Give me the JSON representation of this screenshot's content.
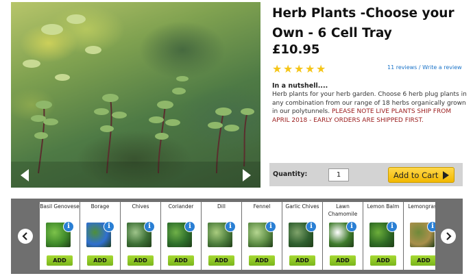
{
  "product": {
    "title": "Herb Plants -Choose your Own - 6 Cell Tray",
    "price": "£10.95",
    "rating_stars": 5,
    "reviews_count": "11 reviews",
    "reviews_separator": " / ",
    "write_review": "Write a review",
    "nutshell_heading": "In a nutshell....",
    "description": "Herb plants for your herb garden. Choose 6 herb plug plants in any combination from our range of 18 herbs organically grown in our polytunnels.",
    "notice": "PLEASE NOTE LIVE PLANTS SHIP FROM APRIL 2018 - EARLY ORDERS ARE SHIPPED FIRST."
  },
  "cart": {
    "quantity_label": "Quantity:",
    "quantity_value": "1",
    "add_to_cart": "Add to Cart"
  },
  "herbs": [
    {
      "name": "Basil Genovese",
      "add": "ADD",
      "icon": "basil-leaf-icon",
      "colors": [
        "#3f8a2a",
        "#7cc24a"
      ]
    },
    {
      "name": "Borage",
      "add": "ADD",
      "icon": "borage-flower-icon",
      "colors": [
        "#2f6fd0",
        "#4f8f3a"
      ]
    },
    {
      "name": "Chives",
      "add": "ADD",
      "icon": "chives-icon",
      "colors": [
        "#3c6f35",
        "#9ec48a"
      ]
    },
    {
      "name": "Coriander",
      "add": "ADD",
      "icon": "coriander-leaf-icon",
      "colors": [
        "#2d6e2a",
        "#6fb048"
      ]
    },
    {
      "name": "Dill",
      "add": "ADD",
      "icon": "dill-icon",
      "colors": [
        "#4c7d3c",
        "#a9cc7e"
      ]
    },
    {
      "name": "Fennel",
      "add": "ADD",
      "icon": "fennel-icon",
      "colors": [
        "#5c8c44",
        "#b5d690"
      ]
    },
    {
      "name": "Garlic Chives",
      "add": "ADD",
      "icon": "garlic-chives-icon",
      "colors": [
        "#2f5f2f",
        "#7fa36a"
      ]
    },
    {
      "name": "Lawn Chamomile",
      "add": "ADD",
      "icon": "chamomile-flower-icon",
      "colors": [
        "#3f7b2c",
        "#ffffff"
      ]
    },
    {
      "name": "Lemon Balm",
      "add": "ADD",
      "icon": "lemon-balm-leaf-icon",
      "colors": [
        "#2e6a24",
        "#6cae3a"
      ]
    },
    {
      "name": "Lemongrass",
      "add": "ADD",
      "icon": "lemongrass-icon",
      "colors": [
        "#a88f4a",
        "#6f8a3a"
      ]
    }
  ],
  "theme": {
    "accent_yellow": "#f2b800",
    "add_green": "#79b51c",
    "link_blue": "#1a73c8",
    "notice_red": "#9a1b1b",
    "carousel_bg": "#6f6f6f"
  }
}
